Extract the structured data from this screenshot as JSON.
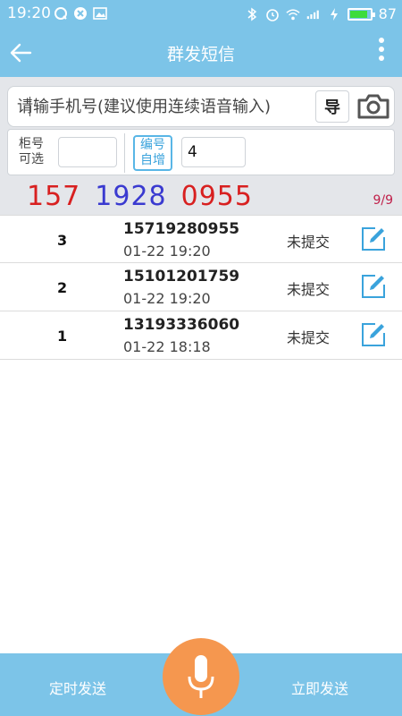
{
  "status_bar": {
    "time": "19:20",
    "battery": "87",
    "battery_level": 0.87,
    "left_icons": [
      "qq-icon",
      "shield-icon",
      "image-icon"
    ],
    "right_icons": [
      "bluetooth-icon",
      "alarm-icon",
      "wifi-icon",
      "signal-icon",
      "charging-icon"
    ]
  },
  "header": {
    "title": "群发短信"
  },
  "input": {
    "placeholder": "请输手机号(建议使用连续语音输入)",
    "import_label": "导"
  },
  "options": {
    "cabinet_label_1": "柜号",
    "cabinet_label_2": "可选",
    "auto_label_1": "编号",
    "auto_label_2": "自增",
    "auto_value": "4"
  },
  "display": {
    "number_part1": "157",
    "number_part2": "1928",
    "number_part3": "0955",
    "counter": "9/9"
  },
  "records": [
    {
      "index": "3",
      "phone": "15719280955",
      "date": "01-22   19:20",
      "status": "未提交"
    },
    {
      "index": "2",
      "phone": "15101201759",
      "date": "01-22   19:20",
      "status": "未提交"
    },
    {
      "index": "1",
      "phone": "13193336060",
      "date": "01-22   18:18",
      "status": "未提交"
    }
  ],
  "bottom": {
    "scheduled_label": "定时发送",
    "send_now_label": "立即发送"
  },
  "colors": {
    "primary": "#7cc4e8",
    "accent": "#f5974f",
    "red": "#d82020",
    "blue": "#3a3ad0"
  }
}
